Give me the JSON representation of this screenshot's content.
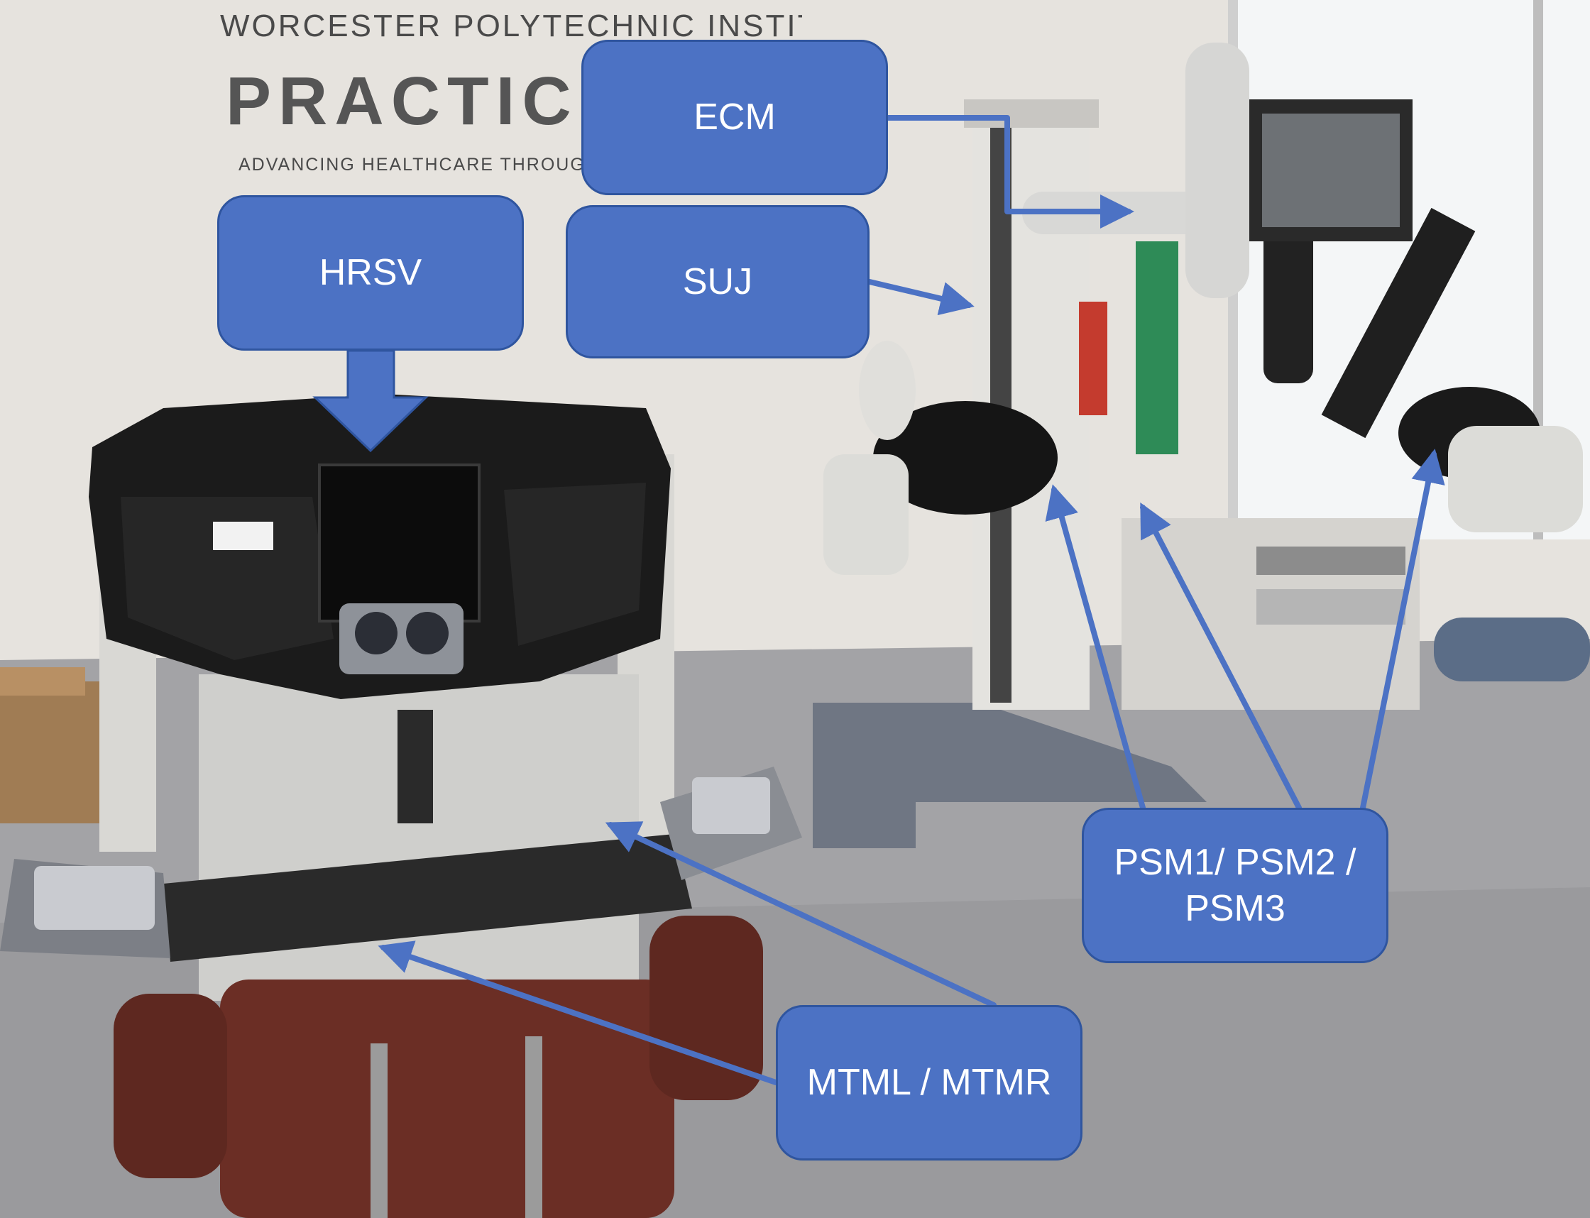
{
  "wall_sign": {
    "line1": "WORCESTER POLYTECHNIC INSTITUTE",
    "line2": "PRACTICE",
    "line3": "ADVANCING HEALTHCARE THROUGH"
  },
  "callouts": {
    "ecm": "ECM",
    "hrsv": "HRSV",
    "suj": "SUJ",
    "psm": "PSM1/ PSM2 / PSM3",
    "mtm": "MTML / MTMR"
  },
  "colors": {
    "callout_fill": "#4c72c4",
    "callout_border": "#2f559f",
    "callout_text": "#ffffff",
    "arrow": "#4c72c4"
  }
}
